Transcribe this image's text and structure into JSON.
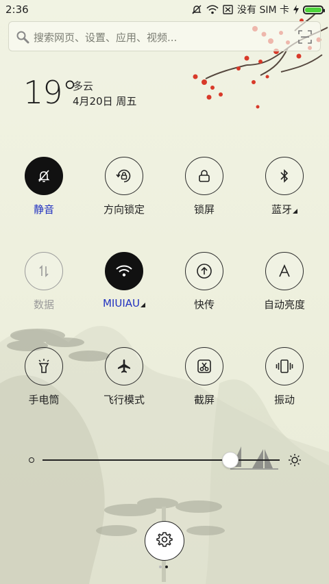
{
  "status": {
    "time": "2:36",
    "carrier": "没有 SIM 卡"
  },
  "search": {
    "placeholder": "搜索网页、设置、应用、视频..."
  },
  "weather": {
    "temperature": "19°",
    "condition": "多云",
    "date": "4月20日 周五"
  },
  "toggles": [
    {
      "label": "静音",
      "icon": "bell-off-icon",
      "state": "on"
    },
    {
      "label": "方向锁定",
      "icon": "rotation-lock-icon",
      "state": "off"
    },
    {
      "label": "锁屏",
      "icon": "lock-icon",
      "state": "off"
    },
    {
      "label": "蓝牙",
      "icon": "bluetooth-icon",
      "state": "off",
      "has_menu": true
    },
    {
      "label": "数据",
      "icon": "mobile-data-icon",
      "state": "disabled"
    },
    {
      "label": "MIUIAU",
      "icon": "wifi-icon",
      "state": "on",
      "has_menu": true
    },
    {
      "label": "快传",
      "icon": "upload-icon",
      "state": "off"
    },
    {
      "label": "自动亮度",
      "icon": "auto-brightness-icon",
      "state": "off"
    },
    {
      "label": "手电筒",
      "icon": "flashlight-icon",
      "state": "off"
    },
    {
      "label": "飞行模式",
      "icon": "airplane-icon",
      "state": "off"
    },
    {
      "label": "截屏",
      "icon": "screenshot-icon",
      "state": "off"
    },
    {
      "label": "振动",
      "icon": "vibrate-icon",
      "state": "off"
    }
  ],
  "brightness": {
    "level": 0.79
  },
  "colors": {
    "active_label": "#2030c0",
    "battery": "#4cd43a"
  }
}
